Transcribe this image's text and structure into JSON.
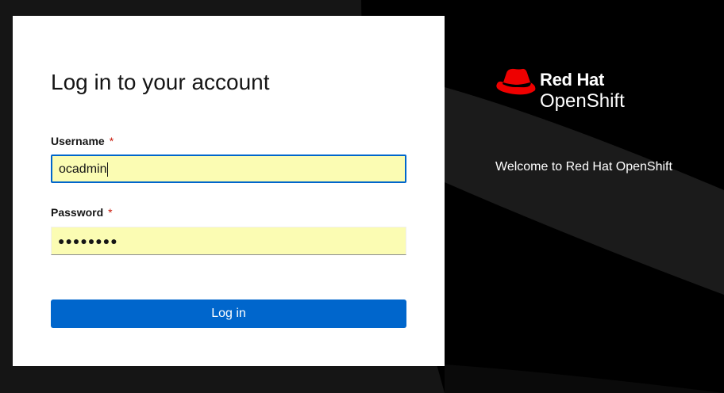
{
  "login": {
    "title": "Log in to your account",
    "username": {
      "label": "Username",
      "required_mark": "*",
      "value": "ocadmin"
    },
    "password": {
      "label": "Password",
      "required_mark": "*",
      "masked_value": "●●●●●●●●"
    },
    "submit_label": "Log in"
  },
  "branding": {
    "logo_icon": "red-hat-fedora-icon",
    "line1": "Red Hat",
    "line2": "OpenShift",
    "welcome_text": "Welcome to Red Hat OpenShift"
  },
  "colors": {
    "accent": "#0066cc",
    "brand_red": "#ee0000",
    "required": "#c9190b",
    "autofill": "#fbfcb3",
    "background": "#151515"
  }
}
